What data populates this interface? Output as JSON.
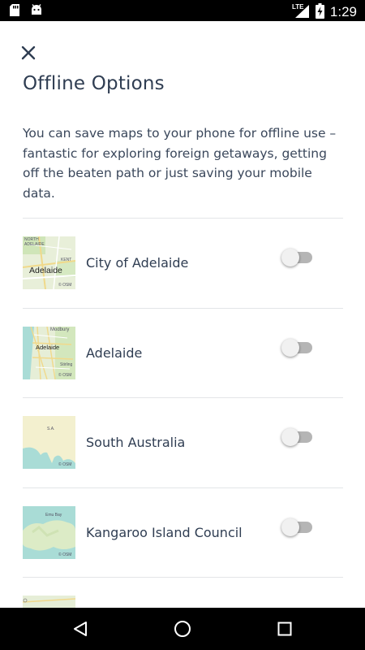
{
  "status_bar": {
    "time": "1:29",
    "network": "LTE",
    "icons": [
      "sd-card-icon",
      "android-icon",
      "signal-icon",
      "battery-charging-icon"
    ]
  },
  "header": {
    "close_icon": "close-icon",
    "title": "Offline Options"
  },
  "description": "You can save maps to your phone for offline use – fantastic for exploring foreign getaways, getting off the beaten path or just saving your mobile data.",
  "regions": [
    {
      "label": "City of Adelaide",
      "enabled": false,
      "thumb_labels": [
        "NORTH",
        "ADELAIDE",
        "KENT",
        "Adelaide",
        "© OSM"
      ]
    },
    {
      "label": "Adelaide",
      "enabled": false,
      "thumb_labels": [
        "Modbury",
        "Adelaide",
        "Stirling",
        "© OSM"
      ]
    },
    {
      "label": "South Australia",
      "enabled": false,
      "thumb_labels": [
        "S.A.",
        "© OSM"
      ]
    },
    {
      "label": "Kangaroo Island Council",
      "enabled": false,
      "thumb_labels": [
        "Emu Bay",
        "© OSM"
      ]
    },
    {
      "label": "",
      "enabled": false,
      "thumb_labels": []
    }
  ],
  "nav_bar": {
    "icons": [
      "back-icon",
      "home-icon",
      "recents-icon"
    ]
  },
  "colors": {
    "text": "#2f3d52",
    "divider": "#e3e5e8",
    "toggle_off_track": "#b5b5b5",
    "toggle_off_knob": "#f1f1f1"
  }
}
